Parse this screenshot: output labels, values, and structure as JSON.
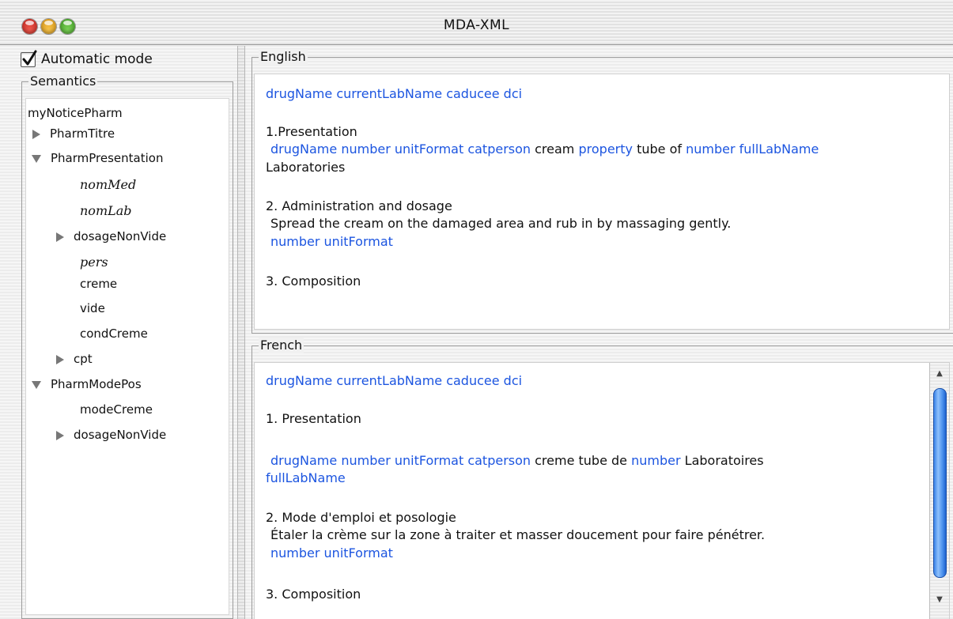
{
  "window": {
    "title": "MDA-XML"
  },
  "auto_mode": {
    "label": "Automatic mode",
    "checked": true
  },
  "semantics": {
    "title": "Semantics",
    "tree": [
      {
        "label": "myNoticePharm"
      },
      {
        "label": "PharmTitre"
      },
      {
        "label": "PharmPresentation"
      },
      {
        "label": "nomMed"
      },
      {
        "label": "nomLab"
      },
      {
        "label": "dosageNonVide"
      },
      {
        "label": "pers"
      },
      {
        "label": "creme"
      },
      {
        "label": "vide"
      },
      {
        "label": "condCreme"
      },
      {
        "label": "cpt"
      },
      {
        "label": "PharmModePos"
      },
      {
        "label": "modeCreme"
      },
      {
        "label": "dosageNonVide"
      }
    ]
  },
  "english": {
    "title": "English",
    "l1": [
      "drugName currentLabName caducee dci"
    ],
    "l2": [
      "1.Presentation"
    ],
    "l3": [
      "drugName number unitFormat catperson",
      " cream ",
      "property",
      " tube of ",
      "number fullLabName"
    ],
    "l4": [
      "Laboratories"
    ],
    "l5": [
      "2. Administration and dosage"
    ],
    "l6": [
      "Spread the cream on the damaged area and rub in by massaging gently."
    ],
    "l7": [
      "number unitFormat"
    ],
    "l8": [
      "3. Composition"
    ]
  },
  "french": {
    "title": "French",
    "l1": [
      "drugName currentLabName caducee dci"
    ],
    "l2": [
      "1. Presentation"
    ],
    "l3": [
      "drugName number unitFormat catperson",
      " creme tube de ",
      "number",
      " Laboratoires"
    ],
    "l4": [
      "fullLabName"
    ],
    "l5": [
      "2. Mode d'emploi et posologie"
    ],
    "l6": [
      "Étaler la crème sur la zone à traiter et masser doucement pour faire pénétrer."
    ],
    "l7": [
      "number unitFormat"
    ],
    "l8": [
      "3. Composition"
    ]
  },
  "colors": {
    "keyword": "#1c55e0",
    "text": "#111111"
  }
}
